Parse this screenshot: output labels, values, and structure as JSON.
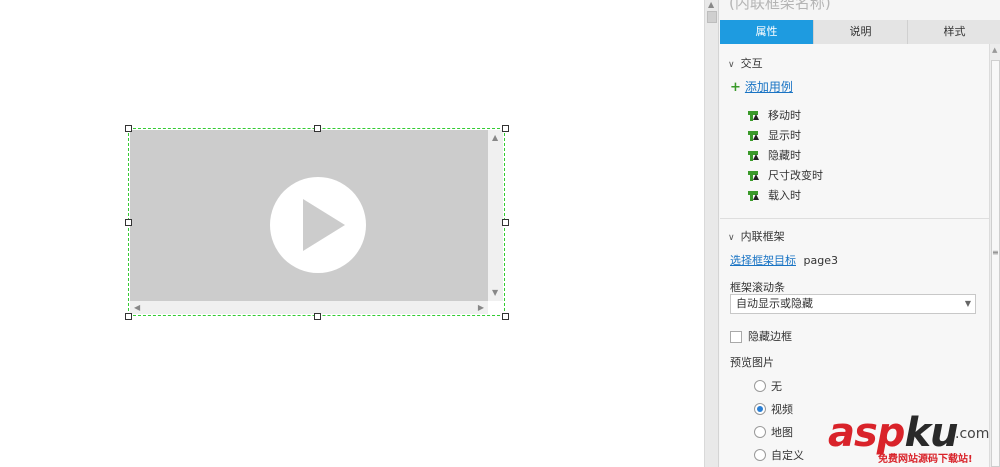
{
  "panel": {
    "title": "(内联框架名称)",
    "tabs": [
      {
        "label": "属性",
        "active": true
      },
      {
        "label": "说明",
        "active": false
      },
      {
        "label": "样式",
        "active": false
      }
    ],
    "interaction": {
      "header": "交互",
      "add_case": "添加用例",
      "events": [
        "移动时",
        "显示时",
        "隐藏时",
        "尺寸改变时",
        "载入时"
      ]
    },
    "inline_frame": {
      "header": "内联框架",
      "select_target_link": "选择框架目标",
      "target_value": "page3",
      "scrollbar_label": "框架滚动条",
      "scrollbar_value": "自动显示或隐藏",
      "hide_border_label": "隐藏边框",
      "preview_label": "预览图片",
      "preview_options": [
        {
          "label": "无",
          "selected": false
        },
        {
          "label": "视频",
          "selected": true
        },
        {
          "label": "地图",
          "selected": false
        },
        {
          "label": "自定义",
          "selected": false
        }
      ]
    }
  },
  "watermark": {
    "brand_a": "asp",
    "brand_b": "ku",
    "suffix": ".com",
    "tagline": "免费网站源码下载站!"
  },
  "colors": {
    "accent": "#1e9be0",
    "selection": "#33cc33",
    "brand_red": "#d9232a"
  }
}
